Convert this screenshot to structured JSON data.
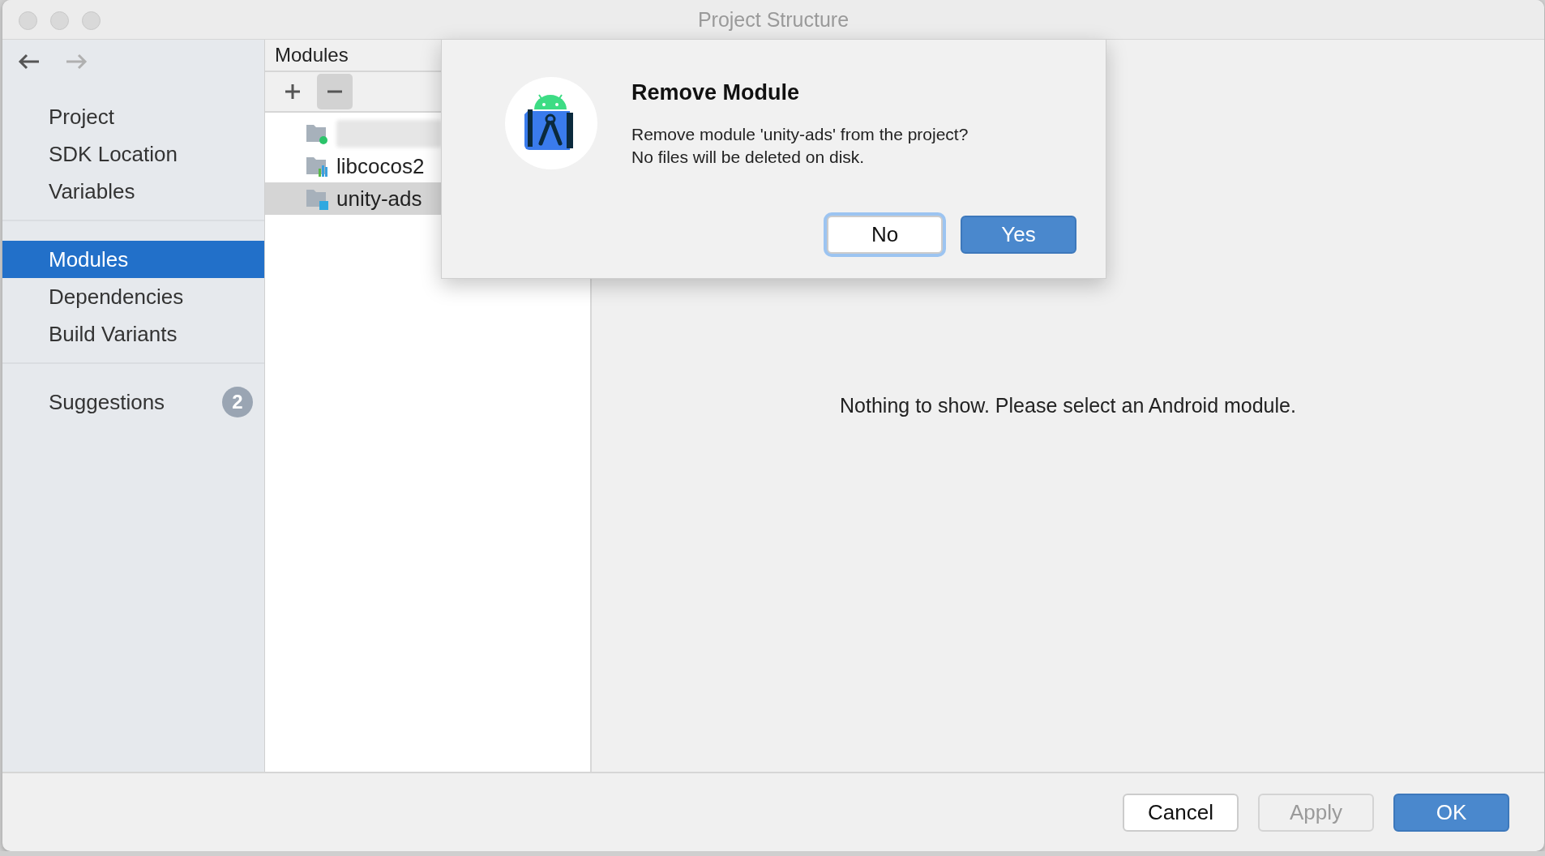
{
  "window": {
    "title": "Project Structure"
  },
  "nav": [
    {
      "kind": "back",
      "disabled": false
    },
    {
      "kind": "forward",
      "disabled": true
    }
  ],
  "sidebar": {
    "groups": [
      {
        "items": [
          {
            "label": "Project",
            "selected": false
          },
          {
            "label": "SDK Location",
            "selected": false
          },
          {
            "label": "Variables",
            "selected": false
          }
        ]
      },
      {
        "items": [
          {
            "label": "Modules",
            "selected": true
          },
          {
            "label": "Dependencies",
            "selected": false
          },
          {
            "label": "Build Variants",
            "selected": false
          }
        ]
      },
      {
        "items": [
          {
            "label": "Suggestions",
            "selected": false,
            "badge": "2"
          }
        ]
      }
    ]
  },
  "modules_panel": {
    "title": "Modules",
    "toolbar": [
      {
        "kind": "add",
        "pressed": false
      },
      {
        "kind": "remove",
        "pressed": true
      }
    ],
    "items": [
      {
        "kind": "app",
        "redacted": true,
        "selected": false
      },
      {
        "kind": "library",
        "label": "libcocos2",
        "redacted": false,
        "selected": false
      },
      {
        "kind": "module",
        "label": "unity-ads",
        "redacted": false,
        "selected": true
      }
    ]
  },
  "content": {
    "message": "Nothing to show. Please select an Android module."
  },
  "footer": {
    "buttons": [
      {
        "label": "Cancel",
        "kind": "default",
        "disabled": false
      },
      {
        "label": "Apply",
        "kind": "default",
        "disabled": true
      },
      {
        "label": "OK",
        "kind": "primary",
        "disabled": false
      }
    ]
  },
  "dialog": {
    "title": "Remove Module",
    "message": [
      "Remove module 'unity-ads' from the project?",
      "No files will be deleted on disk."
    ],
    "buttons": [
      {
        "label": "No",
        "kind": "default",
        "focused": true
      },
      {
        "label": "Yes",
        "kind": "primary",
        "focused": false
      }
    ]
  }
}
